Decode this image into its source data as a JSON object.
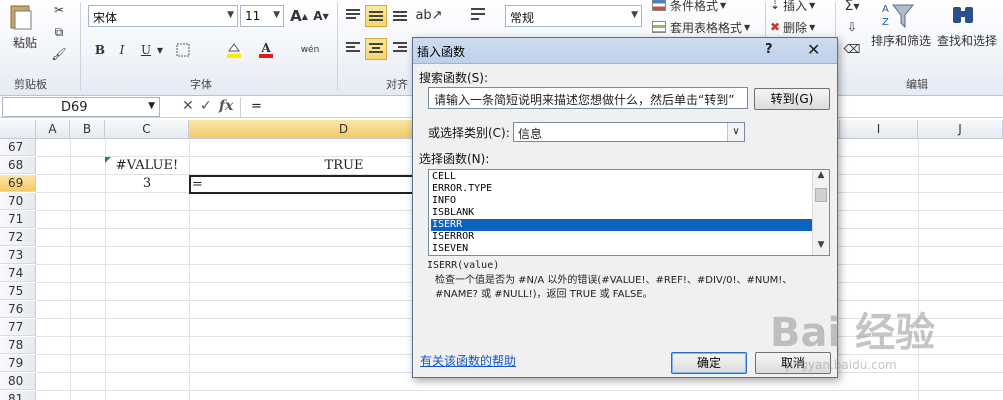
{
  "ribbon": {
    "paste_label": "粘贴",
    "clipboard_group": "剪贴板",
    "font_name": "宋体",
    "font_size": "11",
    "font_group": "字体",
    "align_group": "对齐",
    "number_format": "常规",
    "conditional_format": "条件格式",
    "table_format": "套用表格格式",
    "insert_label": "插入",
    "delete_label": "删除",
    "sort_filter": "排序和筛选",
    "find_select": "查找和选择",
    "edit_group": "编辑",
    "bold": "B",
    "italic": "I",
    "underline": "U",
    "font_grow": "A",
    "font_shrink": "A",
    "sigma": "Σ",
    "wen": "wén"
  },
  "formula_bar": {
    "name_box": "D69",
    "fx": "fx",
    "formula": "="
  },
  "grid": {
    "columns": [
      "A",
      "B",
      "C",
      "D",
      "I",
      "J"
    ],
    "rows": [
      "67",
      "68",
      "69",
      "70",
      "71",
      "72",
      "73",
      "74",
      "75",
      "76",
      "77",
      "78",
      "79",
      "80",
      "81"
    ],
    "c68": "#VALUE!",
    "d68": "TRUE",
    "c69": "3",
    "d69": "="
  },
  "dialog": {
    "title": "插入函数",
    "help": "?",
    "close": "✕",
    "search_label": "搜索函数(S):",
    "search_value": "请输入一条简短说明来描述您想做什么，然后单击“转到”",
    "go_button": "转到(G)",
    "category_label": "或选择类别(C):",
    "category_value": "信息",
    "select_label": "选择函数(N):",
    "functions": [
      "CELL",
      "ERROR.TYPE",
      "INFO",
      "ISBLANK",
      "ISERR",
      "ISERROR",
      "ISEVEN"
    ],
    "selected_function": "ISERR",
    "signature": "ISERR(value)",
    "description": "检查一个值是否为 #N/A 以外的错误(#VALUE!、#REF!、#DIV/0!、#NUM!、#NAME? 或 #NULL!)，返回 TRUE 或 FALSE。",
    "help_link": "有关该函数的帮助",
    "ok": "确定",
    "cancel": "取消"
  },
  "watermark": {
    "brand": "Bai 经验",
    "url": "jingyan.baidu.com"
  },
  "colors": {
    "selection_blue": "#0e63c0",
    "header_selected": "#f4c96b",
    "error_marker": "#1e8c3a",
    "link": "#1155cc"
  }
}
